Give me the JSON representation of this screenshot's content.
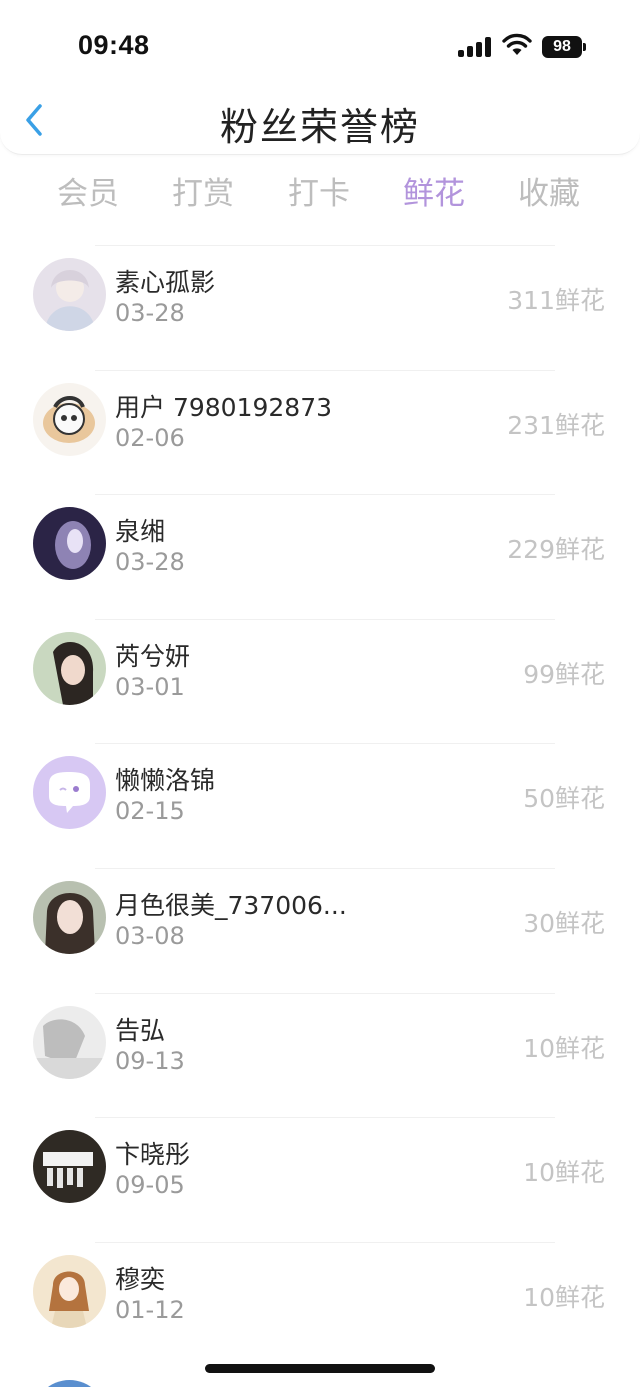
{
  "status_bar": {
    "time": "09:48",
    "battery": "98"
  },
  "header": {
    "title": "粉丝荣誉榜",
    "back_icon": "chevron-left-icon",
    "accent": "#3aa0e6"
  },
  "tabs": [
    {
      "label": "会员",
      "active": false
    },
    {
      "label": "打赏",
      "active": false
    },
    {
      "label": "打卡",
      "active": false
    },
    {
      "label": "鲜花",
      "active": true
    },
    {
      "label": "收藏",
      "active": false
    }
  ],
  "colors": {
    "active_tab": "#b294dc",
    "inactive_tab": "#bdbdbd",
    "count": "#c4c4c4"
  },
  "fans": [
    {
      "name": "素心孤影",
      "date": "03-28",
      "count": "311鲜花"
    },
    {
      "name": "用户 7980192873",
      "date": "02-06",
      "count": "231鲜花"
    },
    {
      "name": "泉缃",
      "date": "03-28",
      "count": "229鲜花"
    },
    {
      "name": "芮兮妍",
      "date": "03-01",
      "count": "99鲜花"
    },
    {
      "name": "懒懒洛锦",
      "date": "02-15",
      "count": "50鲜花"
    },
    {
      "name": "月色很美_737006...",
      "date": "03-08",
      "count": "30鲜花"
    },
    {
      "name": "告弘",
      "date": "09-13",
      "count": "10鲜花"
    },
    {
      "name": "卞晓彤",
      "date": "09-05",
      "count": "10鲜花"
    },
    {
      "name": "穆奕",
      "date": "01-12",
      "count": "10鲜花"
    }
  ]
}
